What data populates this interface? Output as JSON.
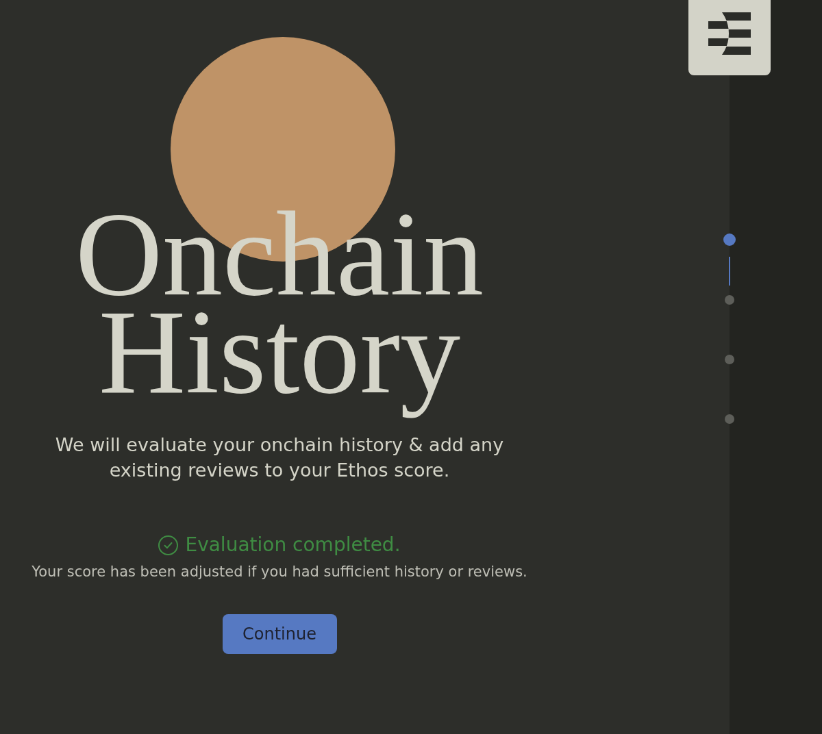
{
  "hero": {
    "title": "Onchain History",
    "description": "We will evaluate your onchain history & add any existing reviews to your Ethos score.",
    "status": {
      "kind": "success",
      "message": "Evaluation completed.",
      "detail": "Your score has been adjusted if you had sufficient history or reviews."
    },
    "continue_button": {
      "label": "Continue"
    }
  },
  "stepper": {
    "steps": [
      {
        "selected": true
      },
      {
        "selected": false
      },
      {
        "selected": false
      },
      {
        "selected": false
      }
    ]
  }
}
